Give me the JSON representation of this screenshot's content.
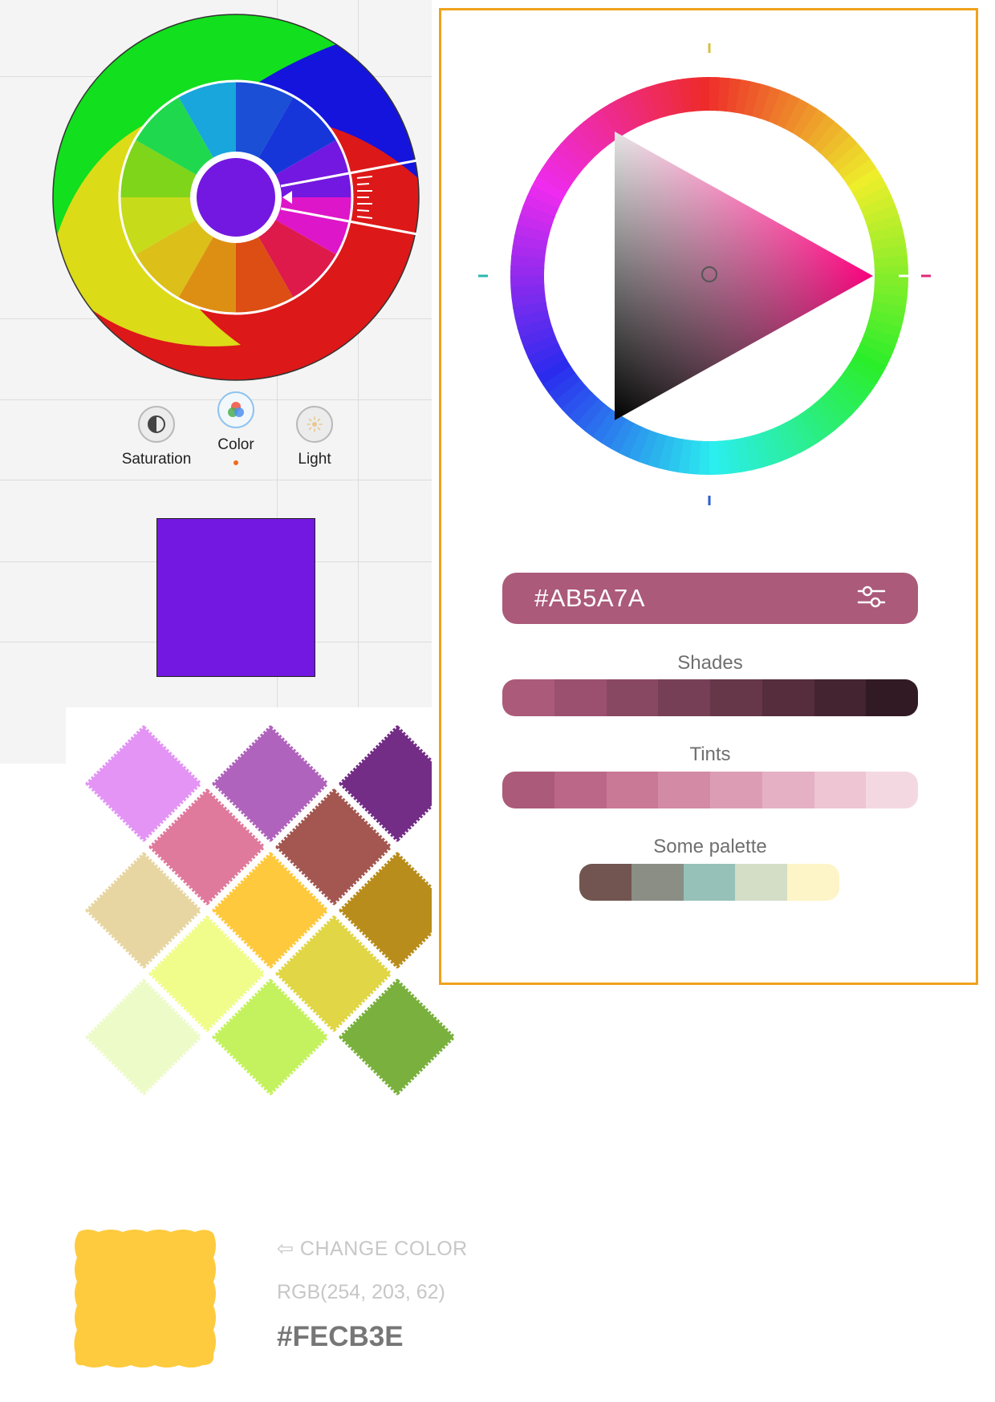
{
  "modes": {
    "saturation": "Saturation",
    "color": "Color",
    "light": "Light"
  },
  "preview_color": "#7318e0",
  "picker": {
    "hex": "#AB5A7A",
    "bar_color": "#ab5a7a",
    "settings_icon": "sliders-icon",
    "shades_label": "Shades",
    "shades": [
      "#ab5a7a",
      "#9a506e",
      "#894862",
      "#773f56",
      "#663649",
      "#552d3d",
      "#442431",
      "#321a24"
    ],
    "tints_label": "Tints",
    "tints": [
      "#ab5a7a",
      "#bb6888",
      "#c97896",
      "#d38aa5",
      "#dc9db4",
      "#e5b0c3",
      "#eec5d2",
      "#f4d8e1"
    ],
    "palette_label": "Some palette",
    "palette": [
      "#725550",
      "#8a8e85",
      "#96c1b8",
      "#d4ddc6",
      "#fdf4c7"
    ]
  },
  "diamonds": [
    "#e394f5",
    "#b063bd",
    "#742d87",
    "#e07a9d",
    "#a35750",
    "#e7d6a2",
    "#ffc93e",
    "#b98d1c",
    "#f0fd8a",
    "#e0d646",
    "#edfbc9",
    "#c4f25f",
    "#7ab13e"
  ],
  "selected_swatch": {
    "color": "#fecb3e",
    "change_label": "CHANGE COLOR",
    "rgb": "RGB(254, 203, 62)",
    "hex": "#FECB3E"
  }
}
